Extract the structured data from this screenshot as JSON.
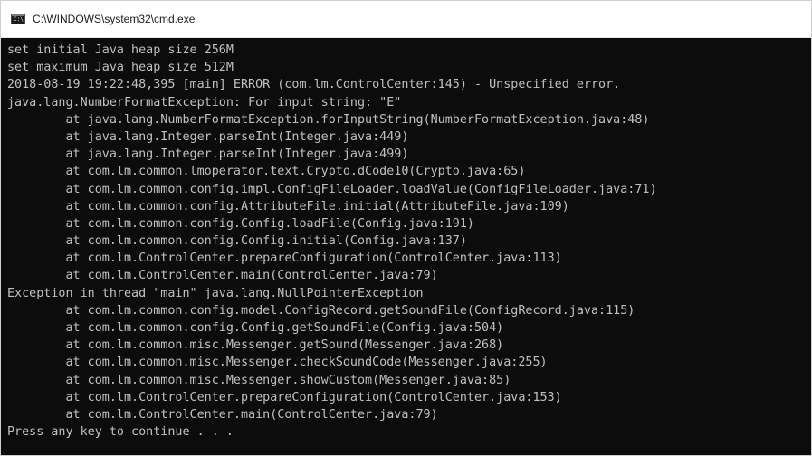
{
  "window": {
    "title": "C:\\WINDOWS\\system32\\cmd.exe",
    "icon": "cmd-console-icon"
  },
  "console": {
    "text_color": "#c0c0c0",
    "background": "#0c0c0c",
    "lines": [
      "set initial Java heap size 256M",
      "set maximum Java heap size 512M",
      "2018-08-19 19:22:48,395 [main] ERROR (com.lm.ControlCenter:145) - Unspecified error.",
      "java.lang.NumberFormatException: For input string: \"E\"",
      "        at java.lang.NumberFormatException.forInputString(NumberFormatException.java:48)",
      "        at java.lang.Integer.parseInt(Integer.java:449)",
      "        at java.lang.Integer.parseInt(Integer.java:499)",
      "        at com.lm.common.lmoperator.text.Crypto.dCode10(Crypto.java:65)",
      "        at com.lm.common.config.impl.ConfigFileLoader.loadValue(ConfigFileLoader.java:71)",
      "        at com.lm.common.config.AttributeFile.initial(AttributeFile.java:109)",
      "        at com.lm.common.config.Config.loadFile(Config.java:191)",
      "        at com.lm.common.config.Config.initial(Config.java:137)",
      "        at com.lm.ControlCenter.prepareConfiguration(ControlCenter.java:113)",
      "        at com.lm.ControlCenter.main(ControlCenter.java:79)",
      "Exception in thread \"main\" java.lang.NullPointerException",
      "        at com.lm.common.config.model.ConfigRecord.getSoundFile(ConfigRecord.java:115)",
      "        at com.lm.common.config.Config.getSoundFile(Config.java:504)",
      "        at com.lm.common.misc.Messenger.getSound(Messenger.java:268)",
      "        at com.lm.common.misc.Messenger.checkSoundCode(Messenger.java:255)",
      "        at com.lm.common.misc.Messenger.showCustom(Messenger.java:85)",
      "        at com.lm.ControlCenter.prepareConfiguration(ControlCenter.java:153)",
      "        at com.lm.ControlCenter.main(ControlCenter.java:79)",
      "Press any key to continue . . ."
    ]
  }
}
